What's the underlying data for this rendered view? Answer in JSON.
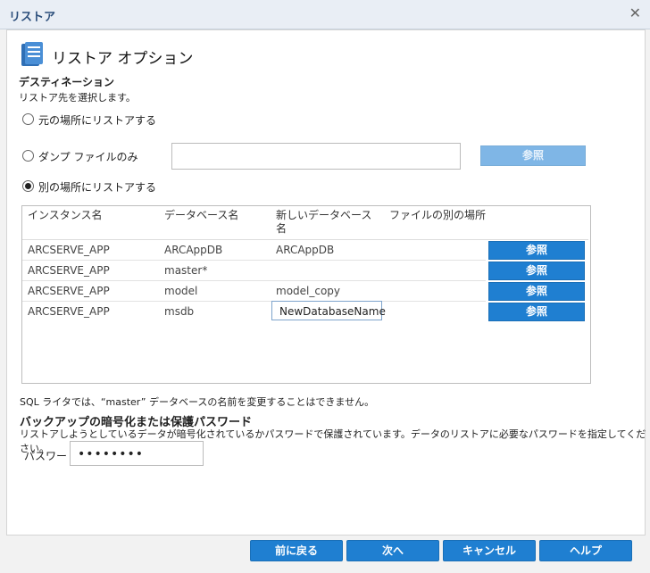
{
  "window": {
    "title": "リストア",
    "close_glyph": "✕"
  },
  "heading": {
    "title": "リストア オプション",
    "icon": "document-stack-icon"
  },
  "destination": {
    "title": "デスティネーション",
    "subtitle": "リストア先を選択します。",
    "options": [
      {
        "label": "元の場所にリストアする",
        "checked": false
      },
      {
        "label": "ダンプ ファイルのみ",
        "checked": false
      },
      {
        "label": "別の場所にリストアする",
        "checked": true
      }
    ],
    "dump_path_value": "",
    "browse_label": "参照"
  },
  "table": {
    "headers": [
      "インスタンス名",
      "データベース名",
      "新しいデータベース名",
      "ファイルの別の場所"
    ],
    "header_lines": [
      "新しいデータベース",
      "名"
    ],
    "rows": [
      {
        "instance": "ARCSERVE_APP",
        "database": "ARCAppDB",
        "new_name": "ARCAppDB",
        "button": "参照"
      },
      {
        "instance": "ARCSERVE_APP",
        "database": "master*",
        "new_name": "",
        "button": "参照"
      },
      {
        "instance": "ARCSERVE_APP",
        "database": "model",
        "new_name": "model_copy",
        "button": "参照"
      },
      {
        "instance": "ARCSERVE_APP",
        "database": "msdb",
        "new_name": "NewDatabaseName",
        "button": "参照"
      }
    ]
  },
  "note": "SQL ライタでは、“master” データベースの名前を変更することはできません。",
  "encryption": {
    "title": "バックアップの暗号化または保護パスワード",
    "subtitle": "リストアしようとしているデータが暗号化されているかパスワードで保護されています。データのリストアに必要なパスワードを指定してください。",
    "password_label": "パスワード",
    "password_value": "••••••••"
  },
  "footer": {
    "back": "前に戻る",
    "next": "次へ",
    "cancel": "キャンセル",
    "help": "ヘルプ"
  },
  "colors": {
    "accent": "#1f7fd1",
    "title_text": "#2a4d7a"
  }
}
